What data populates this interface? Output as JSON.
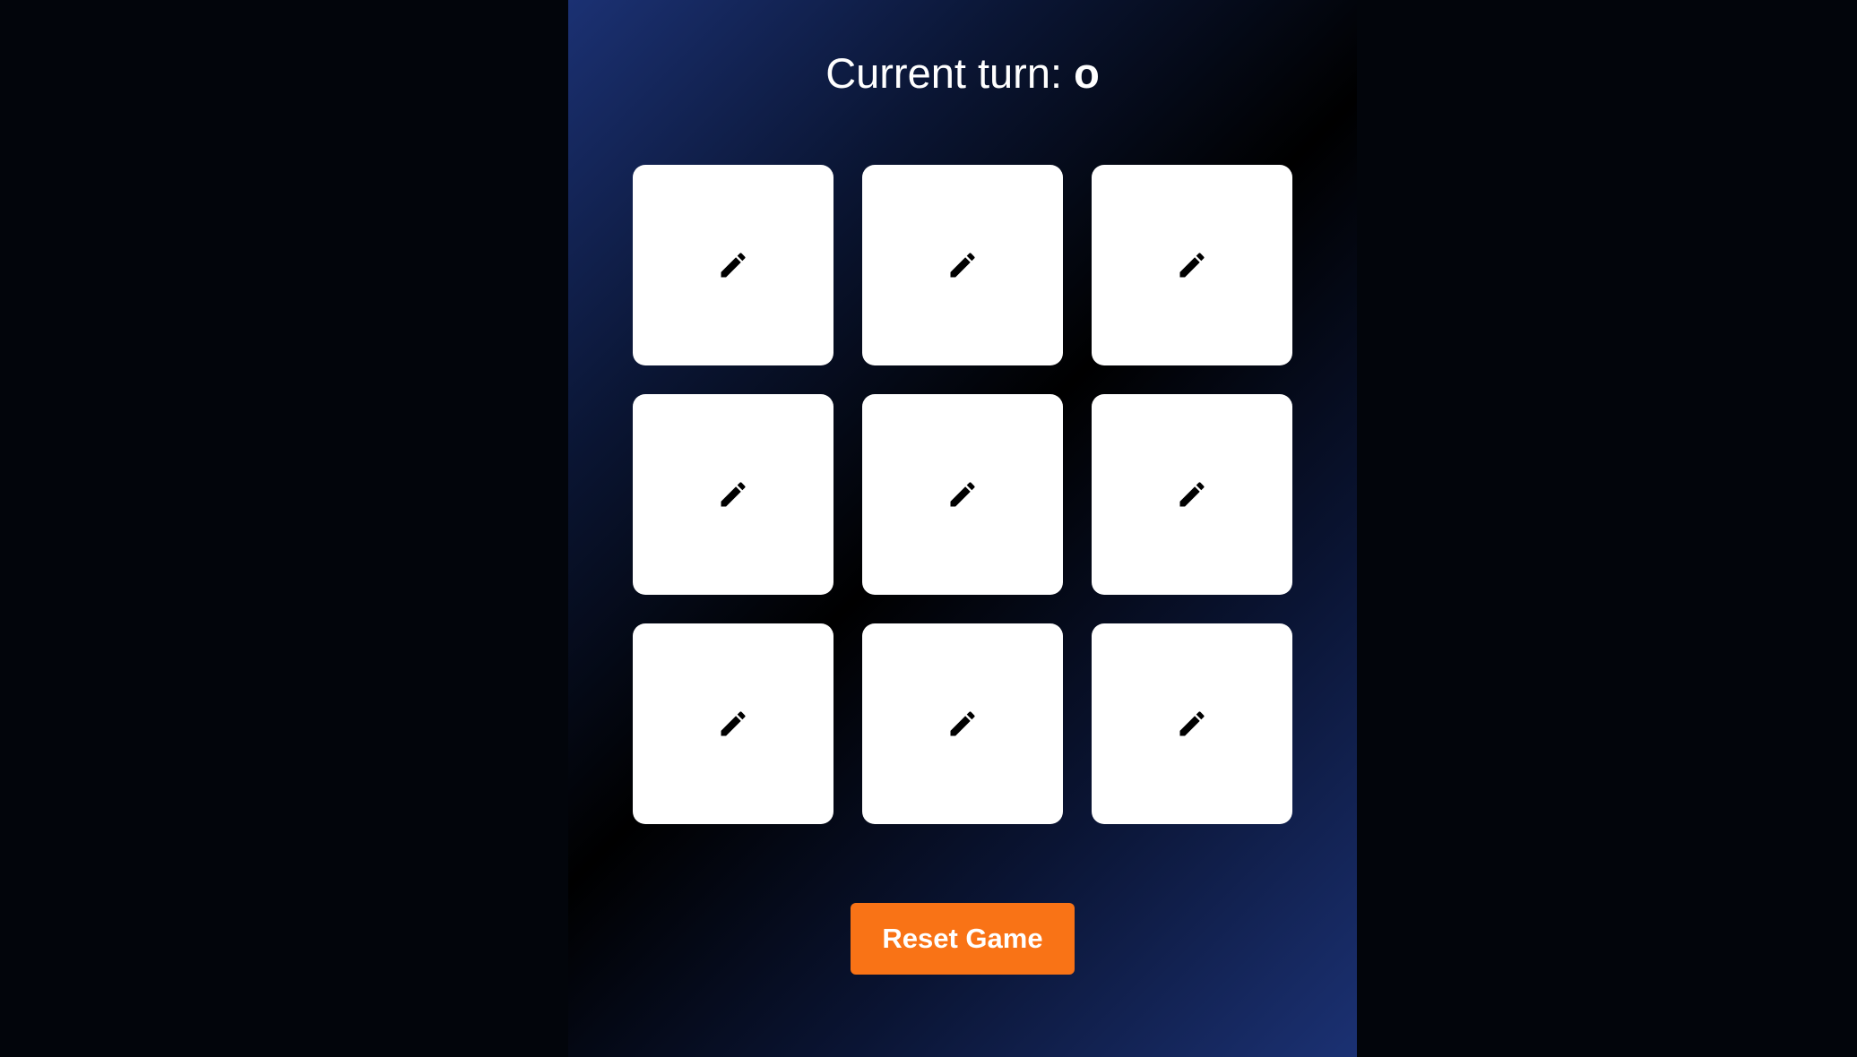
{
  "header": {
    "turn_label": "Current turn: ",
    "current_player": "o"
  },
  "board": {
    "cells": [
      {
        "icon": "pencil-icon"
      },
      {
        "icon": "pencil-icon"
      },
      {
        "icon": "pencil-icon"
      },
      {
        "icon": "pencil-icon"
      },
      {
        "icon": "pencil-icon"
      },
      {
        "icon": "pencil-icon"
      },
      {
        "icon": "pencil-icon"
      },
      {
        "icon": "pencil-icon"
      },
      {
        "icon": "pencil-icon"
      }
    ]
  },
  "controls": {
    "reset_label": "Reset Game"
  },
  "colors": {
    "page_background": "#02050b",
    "gradient_blue": "#1b3173",
    "cell_background": "#ffffff",
    "reset_button": "#f97316"
  }
}
